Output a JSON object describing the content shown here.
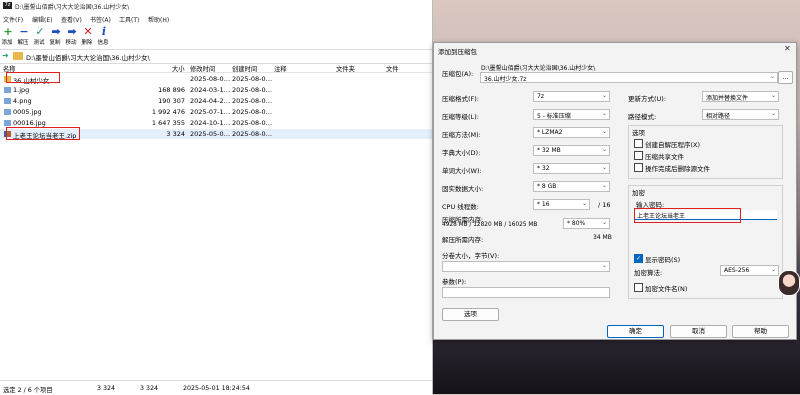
{
  "file_manager": {
    "title": "D:\\墨誓山佰爵\\习大大论治国\\36.山村少女\\",
    "menu": [
      "文件(F)",
      "编辑(E)",
      "查看(V)",
      "书签(A)",
      "工具(T)",
      "帮助(H)"
    ],
    "toolbar": [
      {
        "label": "添加",
        "icon": "plus-icon",
        "color": "#2a9d3a",
        "glyph": "+"
      },
      {
        "label": "解压",
        "icon": "minus-icon",
        "color": "#1e4fbf",
        "glyph": "−"
      },
      {
        "label": "测试",
        "icon": "check-icon",
        "color": "#1a8f8a",
        "glyph": "✓"
      },
      {
        "label": "复制",
        "icon": "copy-arrow-icon",
        "color": "#1e4fbf",
        "glyph": "➡"
      },
      {
        "label": "移动",
        "icon": "move-arrow-icon",
        "color": "#1e4fbf",
        "glyph": "➡"
      },
      {
        "label": "删除",
        "icon": "delete-x-icon",
        "color": "#d32020",
        "glyph": "✕"
      },
      {
        "label": "信息",
        "icon": "info-icon",
        "color": "#1e4fbf",
        "glyph": "i"
      }
    ],
    "address": "D:\\墨誓山佰爵\\习大大论治国\\36.山村少女\\",
    "columns": [
      "名称",
      "大小",
      "修改时间",
      "创建时间",
      "注释",
      "文件夹",
      "文件"
    ],
    "rows": [
      {
        "name": "36.山村少女",
        "size": "",
        "modified": "2025-08-0…",
        "created": "2025-08-0…",
        "type": "folder"
      },
      {
        "name": "1.jpg",
        "size": "168 896",
        "modified": "2024-03-1…",
        "created": "2025-08-0…",
        "type": "image"
      },
      {
        "name": "4.png",
        "size": "190 307",
        "modified": "2024-04-2…",
        "created": "2025-08-0…",
        "type": "image"
      },
      {
        "name": "0005.jpg",
        "size": "1 992 476",
        "modified": "2025-07-1…",
        "created": "2025-08-0…",
        "type": "image"
      },
      {
        "name": "00016.jpg",
        "size": "1 647 355",
        "modified": "2024-10-1…",
        "created": "2025-08-0…",
        "type": "image"
      },
      {
        "name": "上老王论坛当老王.zip",
        "size": "3 324",
        "modified": "2025-05-0…",
        "created": "2025-08-0…",
        "type": "zip"
      }
    ],
    "status": {
      "selected": "选定 2 / 6 个项目",
      "size1": "3 324",
      "size2": "3 324",
      "datetime": "2025-05-01 18:24:54"
    }
  },
  "dialog": {
    "title": "添加到压缩包",
    "archive_label": "压缩包(A):",
    "archive_dir": "D:\\墨誓山佰爵\\习大大论治国\\36.山村少女\\",
    "archive_name": "36.山村少女.7z",
    "browse": "...",
    "left": [
      {
        "label": "压缩格式(F):",
        "value": "7z"
      },
      {
        "label": "压缩等级(L):",
        "value": "5 - 标准压缩"
      },
      {
        "label": "压缩方法(M):",
        "value": "* LZMA2"
      },
      {
        "label": "字典大小(D):",
        "value": "* 32 MB"
      },
      {
        "label": "单词大小(W):",
        "value": "* 32"
      },
      {
        "label": "固实数据大小:",
        "value": "* 8 GB"
      },
      {
        "label": "CPU 线程数:",
        "value": "* 16"
      }
    ],
    "cpu_total": "/ 16",
    "mem_label": "压缩所需内存:",
    "mem_detail": "4928 MB / 12820 MB / 16025 MB",
    "mem_value": "* 80%",
    "decomp_label": "解压所需内存:",
    "decomp_value": "34 MB",
    "split_label": "分卷大小，字节(V):",
    "params_label": "参数(P):",
    "options_btn": "选项",
    "update_label": "更新方式(U):",
    "update_value": "添加并替换文件",
    "path_label": "路径模式:",
    "path_value": "相对路径",
    "options_group": "选项",
    "opt_sfx": "创建自解压程序(X)",
    "opt_shared": "压缩共享文件",
    "opt_delete": "操作完成后删除源文件",
    "encrypt_group": "加密",
    "pw_label": "输入密码:",
    "pw_value": "上老王论坛当老王",
    "show_pw": "显示密码(S)",
    "enc_method_label": "加密算法:",
    "enc_method_value": "AES-256",
    "encrypt_names": "加密文件名(N)",
    "ok": "确定",
    "cancel": "取消",
    "help": "帮助"
  }
}
